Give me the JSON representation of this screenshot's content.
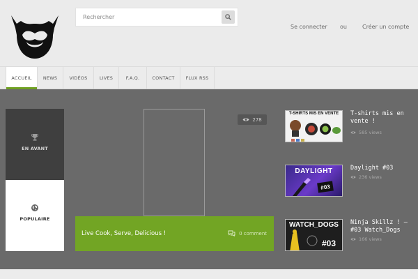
{
  "search": {
    "placeholder": "Rechercher"
  },
  "auth": {
    "login": "Se connecter",
    "or": "ou",
    "register": "Créer un compte"
  },
  "nav": {
    "items": [
      {
        "label": "ACCUEIL"
      },
      {
        "label": "NEWS"
      },
      {
        "label": "VIDÉOS"
      },
      {
        "label": "LIVES"
      },
      {
        "label": "F.A.Q."
      },
      {
        "label": "CONTACT"
      },
      {
        "label": "FLUX RSS"
      }
    ],
    "active": "ACCUEIL"
  },
  "tabs": {
    "featured": "EN AVANT",
    "popular": "POPULAIRE"
  },
  "feature": {
    "views": "278",
    "title": "Live Cook, Serve, Delicious !",
    "comments": "0 comment"
  },
  "posts": [
    {
      "title": "T-shirts mis en vente !",
      "views": "585 views",
      "thumb_text": "T-SHIRTS MIS EN VENTE"
    },
    {
      "title": "Daylight #03",
      "views": "236 views",
      "thumb_text": "DAYLIGHT",
      "thumb_badge": "#03"
    },
    {
      "title": "Ninja Skillz ! – #03 Watch_Dogs",
      "views": "166 views",
      "thumb_text": "WATCH_DOGS",
      "thumb_badge": "#03"
    }
  ],
  "colors": {
    "accent": "#72a524",
    "panel_dark": "#3f3f3f",
    "main_bg": "#6a6a6a",
    "header_bg": "#ebebeb"
  },
  "icons": {
    "search": "search-icon",
    "views": "eye-icon",
    "comments": "comments-icon",
    "featured": "trophy-icon",
    "popular": "globe-icon",
    "logo": "beard-logo"
  }
}
